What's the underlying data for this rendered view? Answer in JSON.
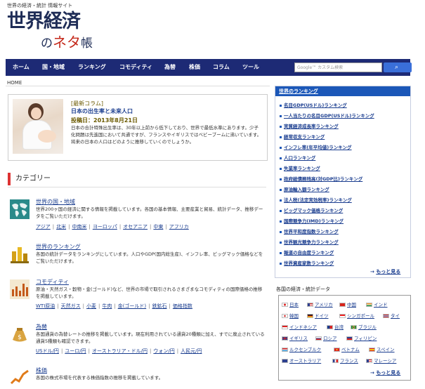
{
  "site": {
    "tagline": "世界の経済・統計 情報サイト",
    "logo_line1": "世界経済",
    "logo_no": "の",
    "logo_neta": "ネタ",
    "logo_cho": "帳"
  },
  "nav": {
    "items": [
      "ホーム",
      "国・地域",
      "ランキング",
      "コモディティ",
      "為替",
      "株価",
      "コラム",
      "ツール"
    ],
    "search_placeholder": "Google™ カスタム検索",
    "search_icon": "magnifier-icon"
  },
  "breadcrumb": "HOME",
  "column": {
    "tag": "[最新コラム]",
    "title": "日本の出生率と未来人口",
    "date": "投稿日：2013年8月21日",
    "body": "日本の合計特殊出生率は、30年以上前から低下しており、世界で最低水準にあります。少子化問題は先進国において共通ですが、フランスやイギリスではベビーブームに沸いています。将来の日本の人口はどのように推移していくのでしょうか。"
  },
  "categories_heading": "カテゴリー",
  "categories": [
    {
      "title": "世界の国・地域",
      "desc": "世界200ヶ国の経済に関する情報を掲載しています。各国の基本情報、主要産業と貿易、統計データ、推移データをご覧いただけます。",
      "links": [
        "アジア",
        "北米",
        "中南米",
        "ヨーロッパ",
        "オセアニア",
        "中東",
        "アフリカ"
      ],
      "icon": "world-map-icon"
    },
    {
      "title": "世界のランキング",
      "desc": "各国の統計データをランキングにしています。人口やGDP(国内総生産)、インフレ率、ビッグマック価格などをご覧いただけます。",
      "links": [],
      "icon": "trophy-icon"
    },
    {
      "title": "コモディティ",
      "desc": "原油・天然ガス・穀物・金(ゴールド)など、世界の市場で取引されるさまざまなコモディティの国際価格の推移を掲載しています。",
      "links": [
        "WTI原油",
        "天然ガス",
        "小麦",
        "牛肉",
        "金(ゴールド)",
        "鉄鉱石",
        "価格指数"
      ],
      "icon": "commodity-chart-icon"
    },
    {
      "title": "為替",
      "desc": "各国通貨の為替レートの推移を掲載しています。現在利用されている通貨20種類に加え、すでに廃止されている通貨5種類も確認できます。",
      "links": [
        "USドル/円",
        "ユーロ/円",
        "オーストラリア・ドル/円",
        "ウォン/円",
        "人民元/円"
      ],
      "icon": "currency-bag-icon"
    },
    {
      "title": "株価",
      "desc": "各国の株式市場を代表する株価指数の推移を掲載しています。",
      "links": [],
      "icon": "stock-chart-icon"
    }
  ],
  "ranking": {
    "heading": "世界のランキング",
    "items": [
      "名目GDP(USドル)ランキング",
      "一人当たりの名目GDP(USドル)ランキング",
      "実質経済成長率ランキング",
      "経常収支ランキング",
      "インフレ率(年平均値)ランキング",
      "人口ランキング",
      "失業率ランキング",
      "政府総債務残高(対GDP比)ランキング",
      "原油輸入額ランキング",
      "法人税(法定実効税率)ランキング",
      "ビッグマック価格ランキング",
      "国際競争力(IMD)ランキング",
      "世界平和度指数ランキング",
      "世界観光競争力ランキング",
      "報道の自由度ランキング",
      "世界資産家数ランキング"
    ],
    "more": "もっと見る"
  },
  "countries": {
    "heading": "各国の経済・統計データ",
    "rows": [
      [
        "日本",
        "アメリカ",
        "中国",
        "インド"
      ],
      [
        "韓国",
        "ドイツ",
        "シンガポール",
        "タイ"
      ],
      [
        "インドネシア",
        "台湾",
        "ブラジル"
      ],
      [
        "イギリス",
        "ロシア",
        "フィリピン"
      ],
      [
        "ルクセンブルク",
        "ベトナム",
        "スペイン"
      ],
      [
        "オーストラリア",
        "フランス",
        "マレーシア"
      ]
    ],
    "more": "もっと見る"
  },
  "colors": {
    "nav_bg": "#1d2a75",
    "link": "#1a3d8f",
    "ranking_head": "#1b57b8",
    "accent_red": "#d33",
    "search_button": "#3a6fd9"
  }
}
